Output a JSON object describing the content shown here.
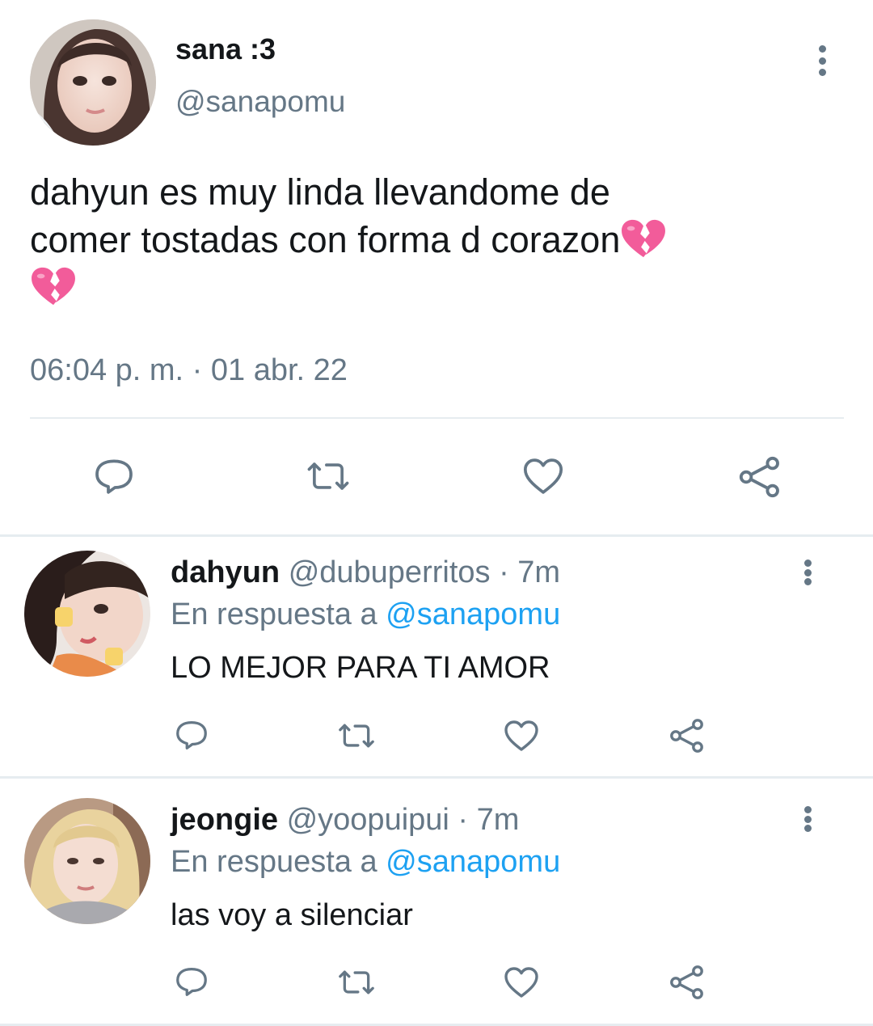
{
  "main_tweet": {
    "display_name": "sana :3",
    "handle": "@sanapomu",
    "text_line1": "dahyun es muy linda llevandome de",
    "text_line2": "comer tostadas con forma d corazon",
    "emoji": "broken-heart",
    "timestamp": "06:04 p. m. · 01 abr. 22",
    "avatar": "avatar-photo"
  },
  "replies": [
    {
      "display_name": "dahyun",
      "handle": "@dubuperritos",
      "time": "· 7m",
      "reply_prefix": "En respuesta a",
      "reply_to": "@sanapomu",
      "text": "LO MEJOR PARA TI AMOR",
      "avatar": "avatar-photo"
    },
    {
      "display_name": "jeongie",
      "handle": "@yoopuipui",
      "time": "· 7m",
      "reply_prefix": "En respuesta a",
      "reply_to": "@sanapomu",
      "text": "las voy a silenciar",
      "avatar": "avatar-photo"
    }
  ],
  "icons": {
    "reply": "reply-icon",
    "retweet": "retweet-icon",
    "like": "like-icon",
    "share": "share-icon",
    "more": "more-vertical-icon"
  },
  "colors": {
    "text_primary": "#14171a",
    "text_secondary": "#657786",
    "link": "#1da1f2",
    "divider": "#e6ecf0",
    "emoji_pink": "#f25c9a"
  }
}
